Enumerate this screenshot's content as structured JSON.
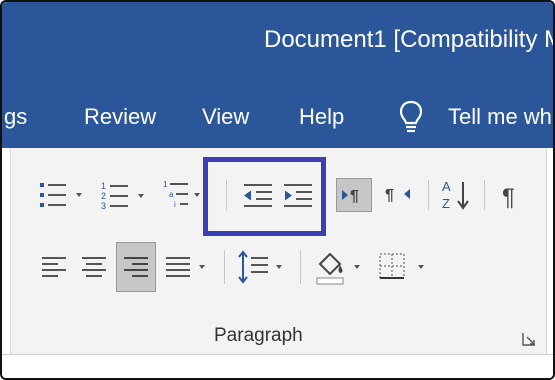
{
  "window": {
    "title": "Document1  [Compatibility M"
  },
  "tabs": [
    {
      "label": "gs"
    },
    {
      "label": "Review"
    },
    {
      "label": "View"
    },
    {
      "label": "Help"
    },
    {
      "label": "Tell me wh"
    }
  ],
  "ribbon": {
    "group_label": "Paragraph",
    "icons": [
      "bullets-icon",
      "numbering-icon",
      "multilevel-list-icon",
      "decrease-indent-icon",
      "increase-indent-icon",
      "ltr-text-direction-icon",
      "rtl-text-direction-icon",
      "sort-icon",
      "show-formatting-marks-icon",
      "align-left-icon",
      "center-icon",
      "align-right-icon",
      "justify-icon",
      "line-spacing-icon",
      "shading-icon",
      "borders-icon",
      "dialog-launcher-icon"
    ],
    "sort_letters": {
      "top": "A",
      "bottom": "Z"
    },
    "pilcrow": "¶"
  },
  "colors": {
    "title_bar": "#2b579a",
    "ribbon": "#f3f3f3",
    "highlight": "#3b3fb6",
    "accent": "#2b579a"
  }
}
